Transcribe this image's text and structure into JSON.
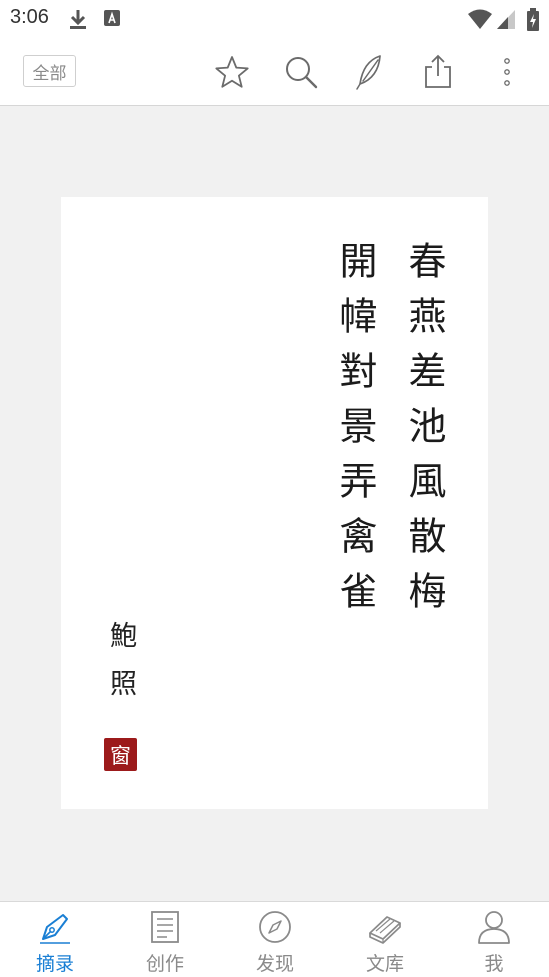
{
  "status_bar": {
    "time": "3:06"
  },
  "toolbar": {
    "filter_label": "全部"
  },
  "poem": {
    "columns": [
      "春燕差池風散梅",
      "開幃對景弄禽雀"
    ],
    "author": "鮑照",
    "seal": "窗"
  },
  "bottom_nav": {
    "items": [
      {
        "label": "摘录",
        "icon": "fountain-pen-icon",
        "active": true
      },
      {
        "label": "创作",
        "icon": "document-icon",
        "active": false
      },
      {
        "label": "发现",
        "icon": "compass-icon",
        "active": false
      },
      {
        "label": "文库",
        "icon": "books-icon",
        "active": false
      },
      {
        "label": "我",
        "icon": "person-icon",
        "active": false
      }
    ]
  },
  "colors": {
    "accent": "#1a7fd4",
    "seal": "#9c1a1b",
    "background": "#f1f1f1"
  }
}
